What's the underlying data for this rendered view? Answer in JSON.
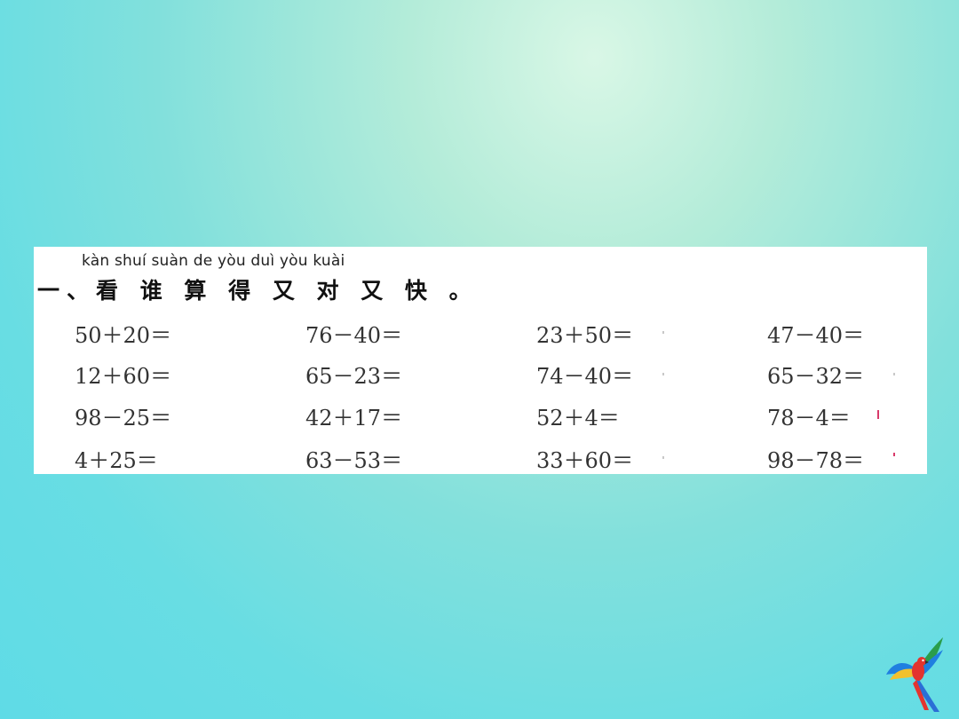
{
  "exercise": {
    "pinyin": "kàn shuí suàn de yòu duì yòu kuài",
    "title": "一、看 谁 算 得 又 对 又 快 。",
    "rows": [
      [
        "50＋20＝",
        "76－40＝",
        "23＋50＝",
        "47－40＝"
      ],
      [
        "12＋60＝",
        "65－23＝",
        "74－40＝",
        "65－32＝"
      ],
      [
        "98－25＝",
        "42＋17＝",
        "52＋4＝",
        "78－4＝"
      ],
      [
        "4＋25＝",
        "63－53＝",
        "33＋60＝",
        "98－78＝"
      ]
    ]
  },
  "colors": {
    "background": "#68dde3",
    "card": "#ffffff",
    "text": "#333333",
    "accent_mark": "#d83a6a"
  },
  "icons": {
    "corner_logo": "parrot-icon"
  }
}
